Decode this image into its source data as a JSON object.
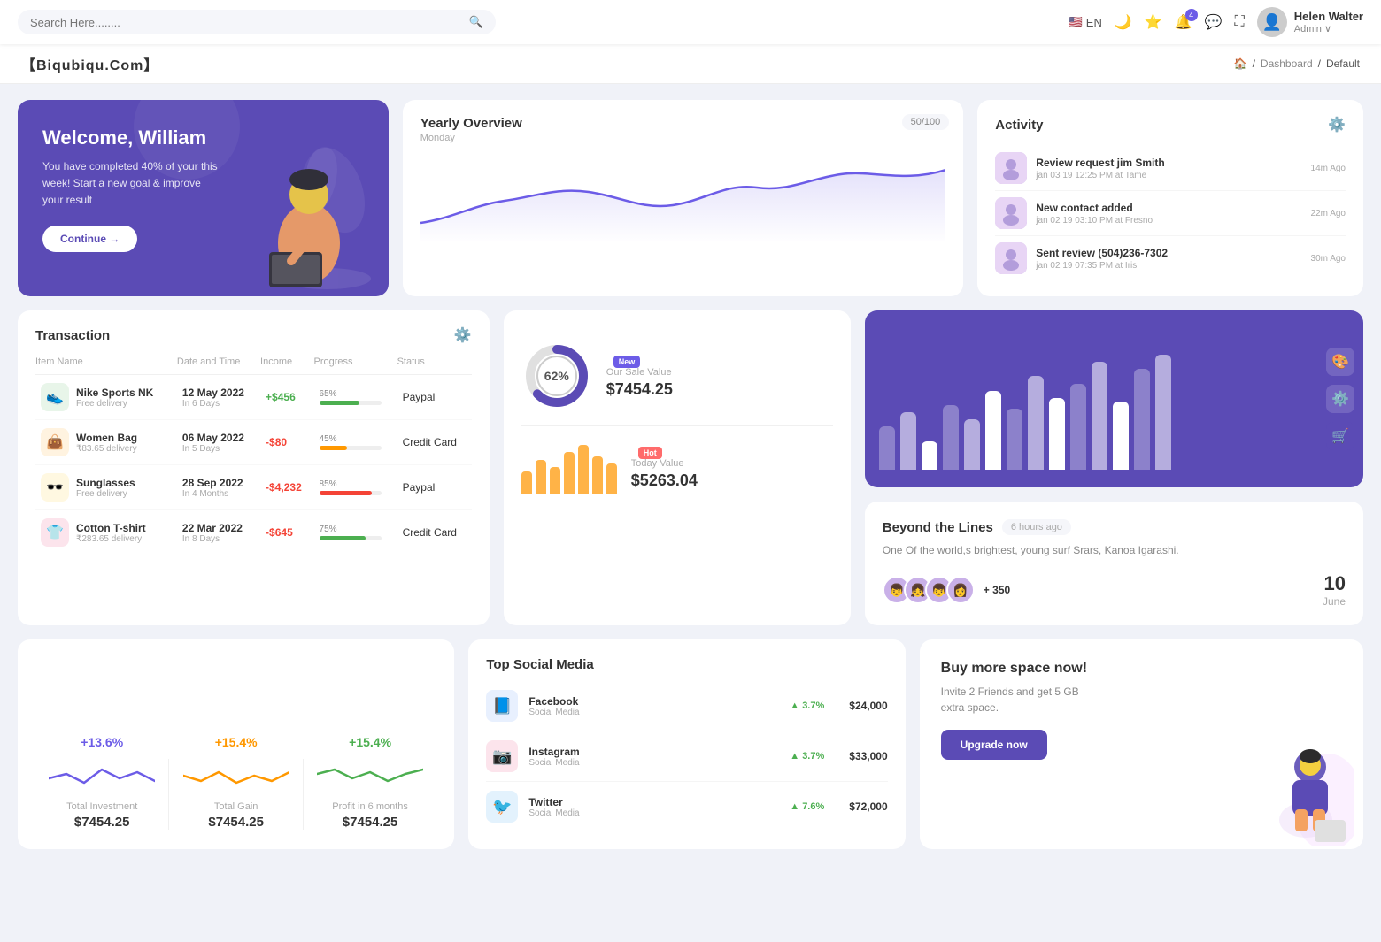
{
  "brand": "【Biqubiqu.Com】",
  "breadcrumb": {
    "home": "🏠",
    "dashboard": "Dashboard",
    "current": "Default"
  },
  "topnav": {
    "search_placeholder": "Search Here........",
    "lang": "EN",
    "notification_count": "4",
    "user_name": "Helen Walter",
    "user_role": "Admin ∨"
  },
  "welcome": {
    "title": "Welcome, William",
    "subtitle": "You have completed 40% of your this week! Start a new goal & improve your result",
    "button": "Continue →"
  },
  "yearly": {
    "title": "Yearly Overview",
    "subtitle": "Monday",
    "badge": "50/100"
  },
  "activity": {
    "title": "Activity",
    "items": [
      {
        "title": "Review request jim Smith",
        "sub": "jan 03 19 12:25 PM at Tame",
        "time": "14m Ago",
        "icon": "🖼️"
      },
      {
        "title": "New contact added",
        "sub": "jan 02 19 03:10 PM at Fresno",
        "time": "22m Ago",
        "icon": "🖼️"
      },
      {
        "title": "Sent review (504)236-7302",
        "sub": "jan 02 19 07:35 PM at Iris",
        "time": "30m Ago",
        "icon": "🖼️"
      }
    ]
  },
  "transaction": {
    "title": "Transaction",
    "columns": [
      "Item Name",
      "Date and Time",
      "Income",
      "Progress",
      "Status"
    ],
    "rows": [
      {
        "name": "Nike Sports NK",
        "sub": "Free delivery",
        "date": "12 May 2022",
        "days": "In 6 Days",
        "income": "+$456",
        "positive": true,
        "progress": 65,
        "progress_color": "#4caf50",
        "status": "Paypal",
        "icon": "👟",
        "icon_bg": "#e8f5e9"
      },
      {
        "name": "Women Bag",
        "sub": "₹83.65 delivery",
        "date": "06 May 2022",
        "days": "In 5 Days",
        "income": "-$80",
        "positive": false,
        "progress": 45,
        "progress_color": "#ff9800",
        "status": "Credit Card",
        "icon": "👜",
        "icon_bg": "#fff3e0"
      },
      {
        "name": "Sunglasses",
        "sub": "Free delivery",
        "date": "28 Sep 2022",
        "days": "In 4 Months",
        "income": "-$4,232",
        "positive": false,
        "progress": 85,
        "progress_color": "#f44336",
        "status": "Paypal",
        "icon": "🕶️",
        "icon_bg": "#fff8e1"
      },
      {
        "name": "Cotton T-shirt",
        "sub": "₹283.65 delivery",
        "date": "22 Mar 2022",
        "days": "In 8 Days",
        "income": "-$645",
        "positive": false,
        "progress": 75,
        "progress_color": "#4caf50",
        "status": "Credit Card",
        "icon": "👕",
        "icon_bg": "#fce4ec"
      }
    ]
  },
  "sale_value": {
    "donut_pct": "62%",
    "yearly_label": "Our Sale Value",
    "yearly_value": "$7454.25",
    "today_label": "Today Value",
    "today_value": "$5263.04",
    "new_badge": "New",
    "hot_badge": "Hot",
    "bars": [
      30,
      45,
      35,
      55,
      65,
      50,
      40
    ]
  },
  "bar_chart": {
    "bars": [
      60,
      80,
      40,
      90,
      70,
      110,
      85,
      130,
      100,
      120,
      150,
      95,
      140,
      160
    ]
  },
  "beyond": {
    "title": "Beyond the Lines",
    "time": "6 hours ago",
    "desc": "One Of the world,s brightest, young surf Srars, Kanoa Igarashi.",
    "avatars": [
      "👦",
      "👧",
      "👦",
      "👩"
    ],
    "plus_count": "+ 350",
    "date_day": "10",
    "date_month": "June"
  },
  "stats": [
    {
      "pct": "+13.6%",
      "color": "purple",
      "label": "Total Investment",
      "value": "$7454.25"
    },
    {
      "pct": "+15.4%",
      "color": "orange",
      "label": "Total Gain",
      "value": "$7454.25"
    },
    {
      "pct": "+15.4%",
      "color": "green",
      "label": "Profit in 6 months",
      "value": "$7454.25"
    }
  ],
  "social": {
    "title": "Top Social Media",
    "items": [
      {
        "name": "Facebook",
        "sub": "Social Media",
        "growth": "3.7%",
        "revenue": "$24,000",
        "icon": "📘",
        "icon_bg": "#e8f0fe"
      },
      {
        "name": "Instagram",
        "sub": "Social Media",
        "growth": "3.7%",
        "revenue": "$33,000",
        "icon": "📷",
        "icon_bg": "#fce4ec"
      },
      {
        "name": "Twitter",
        "sub": "Social Media",
        "growth": "7.6%",
        "revenue": "$72,000",
        "icon": "🐦",
        "icon_bg": "#e3f2fd"
      }
    ]
  },
  "buy_space": {
    "title": "Buy more space now!",
    "desc": "Invite 2 Friends and get 5 GB extra space.",
    "button": "Upgrade now"
  },
  "sidebar_icons": [
    "🎨",
    "⚙️",
    "🛒"
  ]
}
